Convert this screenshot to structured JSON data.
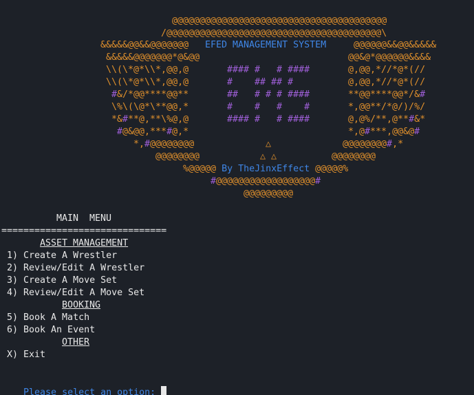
{
  "colors": {
    "background": "#1d2128",
    "text": "#e8e8e8",
    "orange": "#e0902c",
    "purple": "#9f5fd8",
    "blue": "#3f86e6"
  },
  "banner": {
    "art_01": "@@@@@@@@@@@@@@@@@@@@@@@@@@@@@@@@@@@@@@@",
    "art_02": "/@@@@@@@@@@@@@@@@@@@@@@@@@@@@@@@@@@@@@@@\\",
    "art_03_l": "&&&&&@@&&@@@@@@@",
    "title": "EFED MANAGEMENT SYSTEM",
    "art_03_r": "@@@@@@&&@@&&&&&",
    "art_04_l": "&&&&&@@@@@@@*@&@@",
    "art_04_r": "@@&@*@@@@@@&&&&",
    "art_05_l": "\\\\(\\*@*\\\\*,@@,@",
    "logo_1": "#### #   # ####",
    "art_05_r": "@,@@,*//*@*(//",
    "art_06_l": "\\\\(\\*@*\\\\*,@@,@",
    "logo_2": "#    ## ## #",
    "art_06_r": "@,@@,*//*@*(//",
    "art_07_a": "#",
    "art_07_l": "&/*@@****@@**",
    "logo_3": "##   # # # ####",
    "art_07_r": "**@@****@@*/&",
    "art_07_b": "#",
    "art_08_l": "\\%\\(\\@*\\**@@,*",
    "logo_4": "#    #   #    #",
    "art_08_r": "*,@@**/*@/)/%/",
    "art_09_l": "*&",
    "art_09_a": "#",
    "art_09_m": "**@,**\\%@,@",
    "logo_5": "#### #   # ####",
    "art_09_r": "@,@%/**,@**",
    "art_09_b": "#",
    "art_09_c": "&*",
    "art_10_a": "#",
    "art_10_l": "@&@@,***",
    "art_10_b": "#",
    "art_10_m": "@,*",
    "art_10_r1": "*,@",
    "art_10_c": "#",
    "art_10_r2": "***,@@&@",
    "art_10_d": "#",
    "art_11_l1": "*,",
    "art_11_a": "#",
    "art_11_l2": "@@@@@@@@",
    "triangle_1": "△",
    "art_11_r1": "@@@@@@@@",
    "art_11_b": "#",
    "art_11_r2": ",*",
    "art_12_l": "@@@@@@@@",
    "triangle_2": "△ △",
    "art_12_r": "@@@@@@@@",
    "art_13_l": "%@@@@@",
    "byline": "By TheJinxEffect",
    "art_13_r": "@@@@@%",
    "art_14_a": "#",
    "art_14_m": "@@@@@@@@@@@@@@@@@@",
    "art_14_b": "#",
    "art_15": "@@@@@@@@@"
  },
  "menu": {
    "title": "MAIN  MENU",
    "divider": "==============================",
    "section_asset": "ASSET MANAGEMENT",
    "item_1": "1) Create A Wrestler",
    "item_2": "2) Review/Edit A Wrestler",
    "item_3": "3) Create A Move Set",
    "item_4": "4) Review/Edit A Move Set",
    "section_booking": "BOOKING",
    "item_5": "5) Book A Match",
    "item_6": "6) Book An Event",
    "section_other": "OTHER",
    "item_x": "X) Exit"
  },
  "prompt": {
    "text": "Please select an option: ",
    "value": ""
  }
}
